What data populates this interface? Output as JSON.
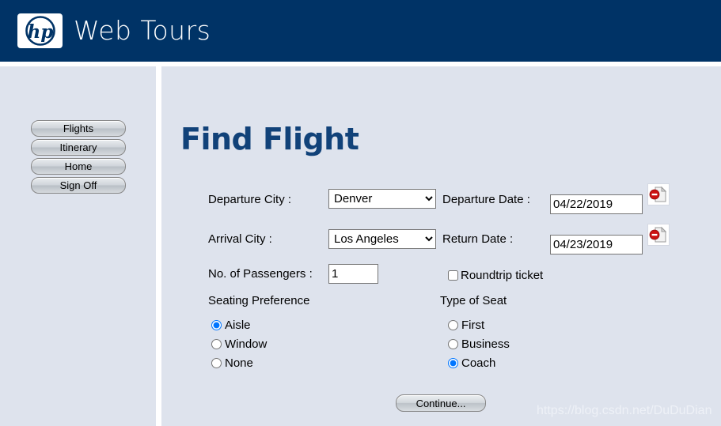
{
  "header": {
    "brand": "Web Tours",
    "logo_alt": "hp-logo"
  },
  "sidebar": {
    "items": [
      {
        "label": "Flights"
      },
      {
        "label": "Itinerary"
      },
      {
        "label": "Home"
      },
      {
        "label": "Sign Off"
      }
    ]
  },
  "main": {
    "title": "Find Flight",
    "fields": {
      "departure_city_label": "Departure City :",
      "departure_city_value": "Denver",
      "departure_city_options": [
        "Denver"
      ],
      "departure_date_label": "Departure Date :",
      "departure_date_value": "04/22/2019",
      "arrival_city_label": "Arrival City :",
      "arrival_city_value": "Los Angeles",
      "arrival_city_options": [
        "Los Angeles"
      ],
      "return_date_label": "Return Date :",
      "return_date_value": "04/23/2019",
      "passengers_label": "No. of Passengers :",
      "passengers_value": "1",
      "roundtrip_label": "Roundtrip ticket",
      "roundtrip_checked": false
    },
    "seating": {
      "title": "Seating Preference",
      "options": [
        {
          "label": "Aisle",
          "selected": true
        },
        {
          "label": "Window",
          "selected": false
        },
        {
          "label": "None",
          "selected": false
        }
      ]
    },
    "seat_type": {
      "title": "Type of Seat",
      "options": [
        {
          "label": "First",
          "selected": false
        },
        {
          "label": "Business",
          "selected": false
        },
        {
          "label": "Coach",
          "selected": true
        }
      ]
    },
    "continue_label": "Continue..."
  },
  "watermark": {
    "text": "https://blog.csdn.net/DuDuDian"
  },
  "colors": {
    "header_blue": "#003366",
    "panel_bg": "#dee3ed",
    "title_blue": "#114279",
    "error_red": "#cc1111"
  }
}
